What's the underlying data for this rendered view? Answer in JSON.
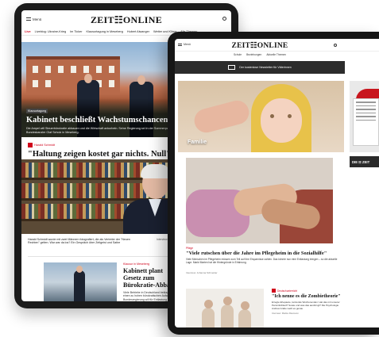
{
  "back_tablet": {
    "menu_label": "Menü",
    "logo": "ZEIT☷ONLINE",
    "nav": [
      "Live",
      "Liveblog: Ukraine-Krieg",
      "Im Ticker",
      "Klausurtagung in Meseberg",
      "Hubert Aiwanger",
      "Wetter und Klima",
      "Alle Themen"
    ],
    "hero": {
      "kicker": "Klausurtagung",
      "headline": "Kabinett beschließt Wachstumschancengesetz",
      "teaser": "Die Ampel will Steuerbürokratie abbauen und die Wirtschaft ankurbeln. Seine Regierung sei in der Sommerpause \"produktiv\" gewesen, sagt Bundeskanzler Olaf Scholz in Meseberg."
    },
    "interview": {
      "kicker": "Harald Schmidt",
      "quote": "\"Haltung zeigen kostet gar nichts. Null\"",
      "caption": "Harald Schmidt wurde mit zwei Männern fotografiert, die als Vertreter der \"Neuen Rechten\" gelten. War war da los? Ein Gespräch über Zeitgeist und Satire",
      "aside": "Interview: Moritz von Uslar und Elisabeth Raether"
    },
    "bottom_article": {
      "kicker": "Klausur in Meseberg",
      "title": "Kabinett plant Gesetz zum Bürokratie-Abbau",
      "teaser": "Viele Betriebe in Deutschland beklagen einen zu hohen bürokratischen Aufwand. Die Bundesregierung will für Entlastung bringen – und 2,3 Milliarden Euro sparen."
    }
  },
  "front_tablet": {
    "menu_label": "Menü",
    "logo": "ZEIT☷ONLINE",
    "nav": [
      "Schule",
      "Beziehungen",
      "Aktuelle Themen"
    ],
    "newsletter": "Der kostenlose Newsletter für Väterinnen",
    "feature_label": "Familie",
    "side_label": "DIE ☷ ZEIT",
    "article": {
      "kicker": "Pflege",
      "headline": "\"Viele rutschen über die Jahre im Pflegeheim in die Sozialhilfe\"",
      "teaser": "Viele Menschen im Pflegeheim müssen zum Teil auf Ihre Ersparnisse zahlen. Das könnte nun eine Entlastung bringen – so die aktuelle Lage. Markt Marten hat die Hintergründe in Erfahrung.",
      "meta": "Interview: Johanna Schneider"
    },
    "bottom_article": {
      "kicker": "Deutschunterricht",
      "title": "\"Ich nenne es die Zombietheorie\"",
      "teaser": "Erregte Ehepaare, tanzende Wochenenden: Hat das mit unserer Persönlichkeit? Sowie und was das ausbringt? Die Psychologie Andrea Grabe weiß es genau.",
      "meta": "Interview: Marike Rasmann"
    }
  },
  "colors": {
    "accent": "#d0021b",
    "device": "#161616",
    "newsletter_bg": "#2c2c2c"
  }
}
